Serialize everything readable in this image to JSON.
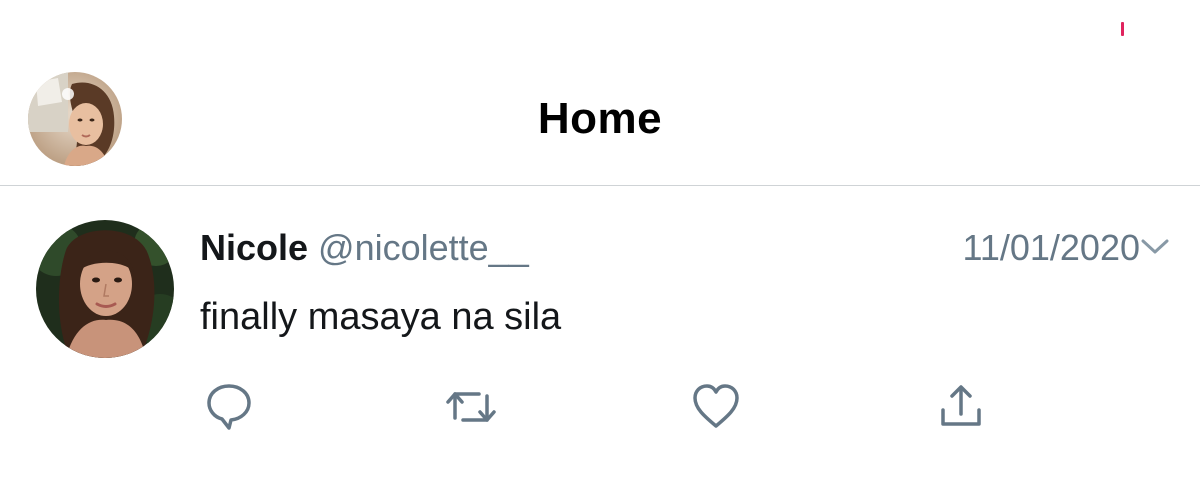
{
  "header": {
    "title": "Home",
    "avatar_icon": "profile-avatar-icon"
  },
  "tweet": {
    "author_name": "Nicole",
    "author_handle": "@nicolette__",
    "date": "11/01/2020",
    "text": "finally masaya na sila",
    "avatar_icon": "author-avatar-icon"
  },
  "actions": [
    {
      "name": "reply",
      "icon": "reply-icon"
    },
    {
      "name": "retweet",
      "icon": "retweet-icon"
    },
    {
      "name": "like",
      "icon": "heart-icon"
    },
    {
      "name": "share",
      "icon": "share-icon"
    }
  ],
  "colors": {
    "text": "#14171a",
    "secondary": "#657786",
    "divider": "#cfd3d6",
    "status_mark": "#e0245e"
  }
}
